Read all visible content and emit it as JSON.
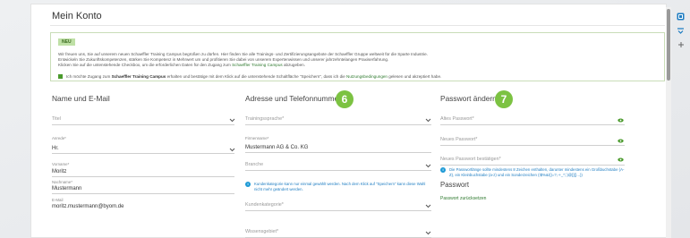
{
  "page": {
    "title": "Mein Konto"
  },
  "notice": {
    "badge": "NEU",
    "line1": "Wir freuen uns, Sie auf unserem neuen Schaeffler Training Campus begrüßen zu dürfen. Hier finden Sie alle Trainings- und Zertifizierungsangebote der Schaeffler Gruppe weltweit für die Sparte Industrie.",
    "line2": "Entwickeln Sie Zukunftskompetenzen, stärken Sie Kompetenz in Mehrwert um und profitieren Sie dabei von unserem Expertenwissen und unserer jahrzehntelangen Praxiserfahrung.",
    "line3_a": "Klicken Sie auf die untenstehende Checkbox, um die erforderlichen Daten für den Zugang zum ",
    "line3_link": "Schaeffler Training Campus",
    "line3_b": " abzugeben.",
    "consent_a": "Ich möchte Zugang zum ",
    "consent_bold": "Schaeffler Training Campus",
    "consent_b": " erhalten und bestätige mit dem Klick auf die untenstehende Schaltfläche \"Speichern\", dass ich die ",
    "consent_link": "Nutzungsbedingungen",
    "consent_c": " gelesen und akzeptiert habe."
  },
  "col1": {
    "heading": "Name und E-Mail",
    "title_placeholder": "Titel",
    "salutation_label": "Anrede*",
    "salutation_value": "Hr.",
    "firstname_label": "Vorname*",
    "firstname_value": "Moritz",
    "lastname_label": "Nachname*",
    "lastname_value": "Mustermann",
    "email_label": "E-Mail",
    "email_value": "moritz.mustermann@byom.de"
  },
  "col2": {
    "heading": "Adresse und Telefonnummer",
    "marker": "6",
    "training_lang_placeholder": "Trainingssprache*",
    "company_label": "Firmenname*",
    "company_value": "Mustermann AG & Co. KG",
    "branch_placeholder": "Branche",
    "info_text": "Kundenkategorie kann nur einmal gewählt werden. Nach dem Klick auf \"Speichern\" kann diese Wahl nicht mehr geändert werden.",
    "customer_cat_placeholder": "Kundenkategorie*",
    "knowledge_placeholder": "Wissensgebiet*"
  },
  "col3": {
    "heading": "Passwort ändern",
    "marker": "7",
    "old_pw_placeholder": "Altes Passwort*",
    "new_pw_placeholder": "Neues Passwort*",
    "confirm_pw_placeholder": "Neues Passwort bestätigen*",
    "pw_info": "Die Passwortlänge sollte mindestens 8 Zeichen enthalten, darunter mindestens ein Großbuchstabe (A-Z), ein Kleinbuchstabe (a-z) und ein Sonderzeichen (!$%&/()=?,-+_*;:)@[]{}...))",
    "section2_heading": "Passwort",
    "reset_link": "Passwort zurücksetzen"
  },
  "colors": {
    "accent_green": "#7cc242",
    "link_green": "#2f7a2f",
    "info_blue": "#1e9ad6"
  },
  "icons": [
    "chevron-down-icon",
    "eye-icon",
    "info-icon",
    "checkbox-icon",
    "settings-icon",
    "collapse-icon",
    "plus-icon"
  ]
}
